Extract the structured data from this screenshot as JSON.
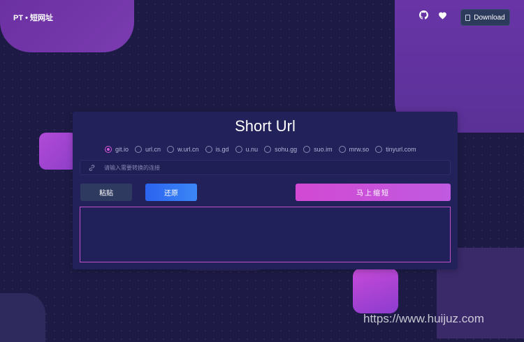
{
  "brand": {
    "name": "PT • 短网址"
  },
  "topbar": {
    "icons": [
      "github-icon",
      "heart-icon"
    ],
    "download_label": "Download"
  },
  "card": {
    "title": "Short Url",
    "services": [
      {
        "label": "git.io",
        "selected": true
      },
      {
        "label": "url.cn",
        "selected": false
      },
      {
        "label": "w.url.cn",
        "selected": false
      },
      {
        "label": "is.gd",
        "selected": false
      },
      {
        "label": "u.nu",
        "selected": false
      },
      {
        "label": "sohu.gg",
        "selected": false
      },
      {
        "label": "suo.im",
        "selected": false
      },
      {
        "label": "mrw.so",
        "selected": false
      },
      {
        "label": "tinyurl.com",
        "selected": false
      }
    ],
    "input": {
      "placeholder": "请输入需要转换的连接",
      "value": ""
    },
    "buttons": {
      "paste": "粘贴",
      "restore": "还原",
      "shorten": "马上缩短"
    },
    "result": ""
  },
  "watermark": "https://www.huijuz.com",
  "colors": {
    "background": "#1d1b45",
    "card": "#22215a",
    "accent_pink": "#d249d3",
    "accent_blue": "#2b63f0"
  }
}
